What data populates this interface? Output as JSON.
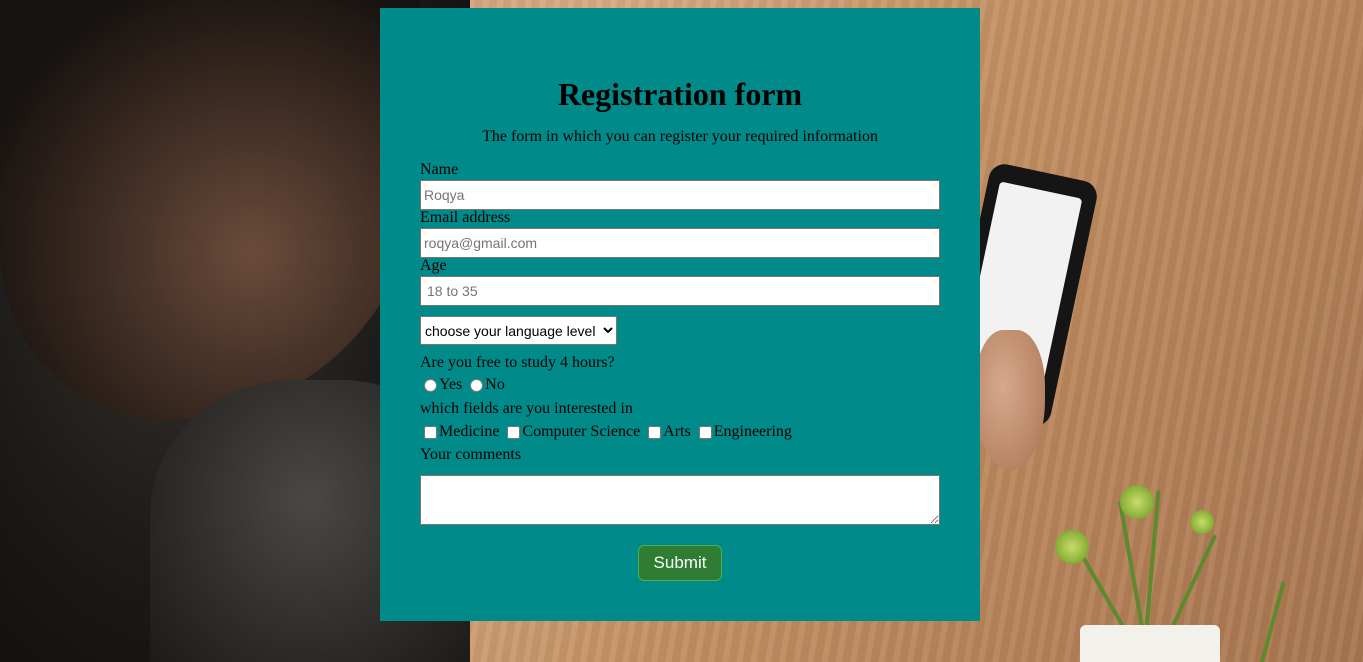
{
  "form": {
    "title": "Registration form",
    "subtitle": "The form in which you can register your required information",
    "name_label": "Name",
    "name_placeholder": "Roqya",
    "email_label": "Email address",
    "email_placeholder": "roqya@gmail.com",
    "age_label": "Age",
    "age_placeholder": "18 to 35",
    "language_select": {
      "selected": "choose your language level"
    },
    "study_question": "Are you free to study 4 hours?",
    "study_options": [
      "Yes",
      "No"
    ],
    "fields_question": "which fields are you interested in",
    "fields_options": [
      "Medicine",
      "Computer Science",
      "Arts",
      "Engineering"
    ],
    "comments_label": "Your comments",
    "submit_label": "Submit"
  },
  "colors": {
    "panel": "#008b8a",
    "submit": "#2e7d32"
  }
}
